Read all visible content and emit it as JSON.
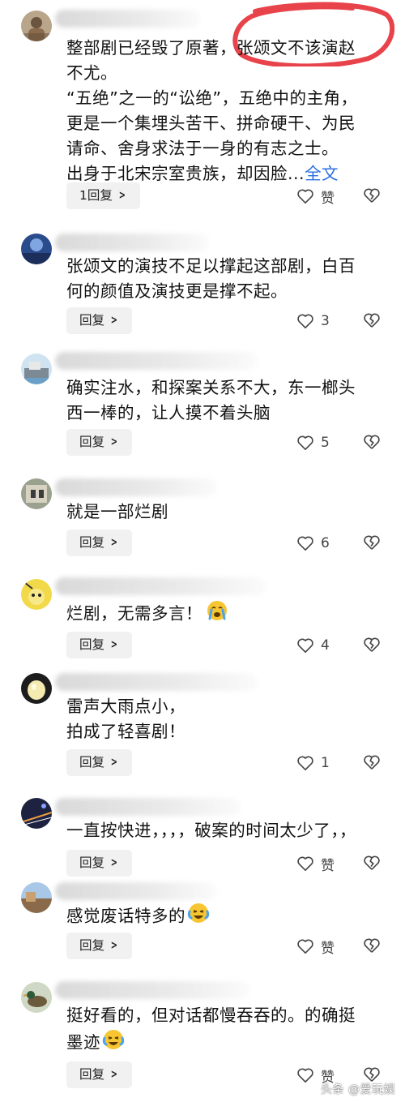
{
  "comments": [
    {
      "text": "整部剧已经毁了原著，张颂文不该演赵\n不尤。\n“五绝”之一的“讼绝”，五绝中的主角，\n更是一个集埋头苦干、拼命硬干、为民\n请命、舍身求法于一身的有志之士。\n出身于北宋宗室贵族，却因脸...",
      "more": "全文",
      "reply": "1回复",
      "likes": "赞"
    },
    {
      "text": "张颂文的演技不足以撑起这部剧，白百\n何的颜值及演技更是撑不起。",
      "reply": "回复",
      "likes": "3"
    },
    {
      "text": "确实注水，和探案关系不大，东一榔头\n西一棒的，让人摸不着头脑",
      "reply": "回复",
      "likes": "5"
    },
    {
      "text": "就是一部烂剧",
      "reply": "回复",
      "likes": "6"
    },
    {
      "text": "烂剧，无需多言！",
      "reply": "回复",
      "likes": "4"
    },
    {
      "text": "雷声大雨点小，\n拍成了轻喜剧！",
      "reply": "回复",
      "likes": "1"
    },
    {
      "text": "一直按快进，，，，破案的时间太少了，，",
      "reply": "回复",
      "likes": "赞"
    },
    {
      "text": "感觉废话特多的",
      "reply": "回复",
      "likes": "赞"
    },
    {
      "text": "挺好看的，但对话都慢吞吞的。的确挺\n墨迹",
      "reply": "回复",
      "likes": "赞"
    }
  ],
  "icons": {
    "like": "heart-outline-icon",
    "dislike": "broken-heart-icon",
    "emoji_cry": "crying-emoji-icon",
    "emoji_laugh": "laughing-tears-emoji-icon"
  },
  "colors": {
    "link": "#2b6fe0",
    "highlight_ring": "#e8434a"
  },
  "watermark": "头条 @爱玩娱"
}
